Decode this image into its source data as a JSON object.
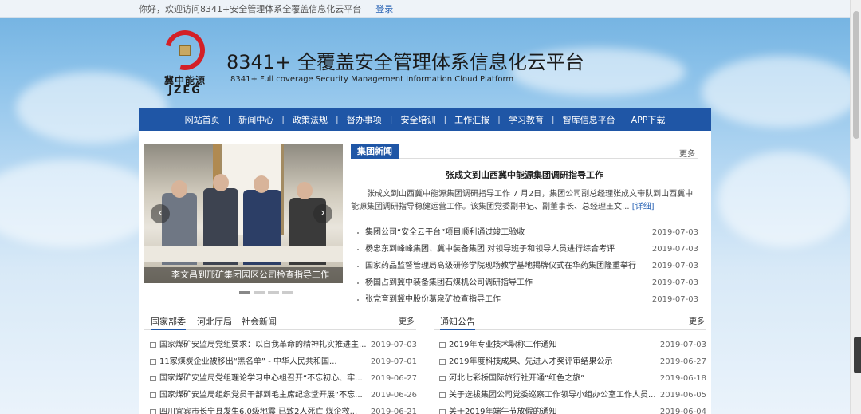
{
  "topbar": {
    "welcome": "你好，欢迎访问8341+安全管理体系全覆盖信息化云平台",
    "login": "登录"
  },
  "logo": {
    "cn": "冀中能源",
    "en": "JZEG"
  },
  "header": {
    "title": "8341+ 全覆盖安全管理体系信息化云平台",
    "subtitle": "8341+ Full coverage Security Management Information Cloud Platform"
  },
  "nav": [
    "网站首页",
    "新闻中心",
    "政策法规",
    "督办事项",
    "安全培训",
    "工作汇报",
    "学习教育",
    "智库信息平台",
    "APP下载"
  ],
  "carousel": {
    "caption": "李文昌到邢矿集团园区公司检查指导工作",
    "prev": "‹",
    "next": "›"
  },
  "group_news": {
    "tab": "集团新闻",
    "more": "更多",
    "headline": "张成文到山西冀中能源集团调研指导工作",
    "summary": "张成文到山西冀中能源集团调研指导工作 7 月2日，集团公司副总经理张成文带队到山西冀中能源集团调研指导稳健运营工作。该集团党委副书记、副董事长、总经理王文...",
    "detail": "[详细]",
    "items": [
      {
        "title": "集团公司“安全云平台”项目顺利通过竣工验收",
        "date": "2019-07-03"
      },
      {
        "title": "杨忠东到峰峰集团、冀中装备集团 对领导班子和领导人员进行综合考评",
        "date": "2019-07-03"
      },
      {
        "title": "国家药品监督管理局高级研修学院现场教学基地揭牌仪式在华药集团隆重举行",
        "date": "2019-07-03"
      },
      {
        "title": "杨国占到冀中装备集团石煤机公司调研指导工作",
        "date": "2019-07-03"
      },
      {
        "title": "张党育到冀中股份葛泉矿检查指导工作",
        "date": "2019-07-03"
      }
    ]
  },
  "left_tabs": {
    "tabs": [
      "国家部委",
      "河北厅局",
      "社会新闻"
    ],
    "more": "更多",
    "items": [
      {
        "title": "国家煤矿安监局党组要求：以自我革命的精神扎实推进主...",
        "date": "2019-07-03"
      },
      {
        "title": "11家煤炭企业被移出“黑名单” - 中华人民共和国...",
        "date": "2019-07-01"
      },
      {
        "title": "国家煤矿安监局党组理论学习中心组召开“不忘初心、牢...",
        "date": "2019-06-27"
      },
      {
        "title": "国家煤矿安监局组织党员干部到毛主席纪念堂开展“不忘...",
        "date": "2019-06-26"
      },
      {
        "title": "四川宜宾市长宁县发生6.0级地震 已致2人死亡 煤企救...",
        "date": "2019-06-21"
      }
    ]
  },
  "notice": {
    "tab": "通知公告",
    "more": "更多",
    "items": [
      {
        "title": "2019年专业技术职称工作通知",
        "date": "2019-07-03"
      },
      {
        "title": "2019年度科技成果、先进人才奖评审结果公示",
        "date": "2019-06-27"
      },
      {
        "title": "河北七彩桥国际旅行社开通“红色之旅”",
        "date": "2019-06-18"
      },
      {
        "title": "关于选拔集团公司党委巡察工作领导小组办公室工作人员...",
        "date": "2019-06-05"
      },
      {
        "title": "关于2019年端午节放假的通知",
        "date": "2019-06-04"
      }
    ]
  }
}
